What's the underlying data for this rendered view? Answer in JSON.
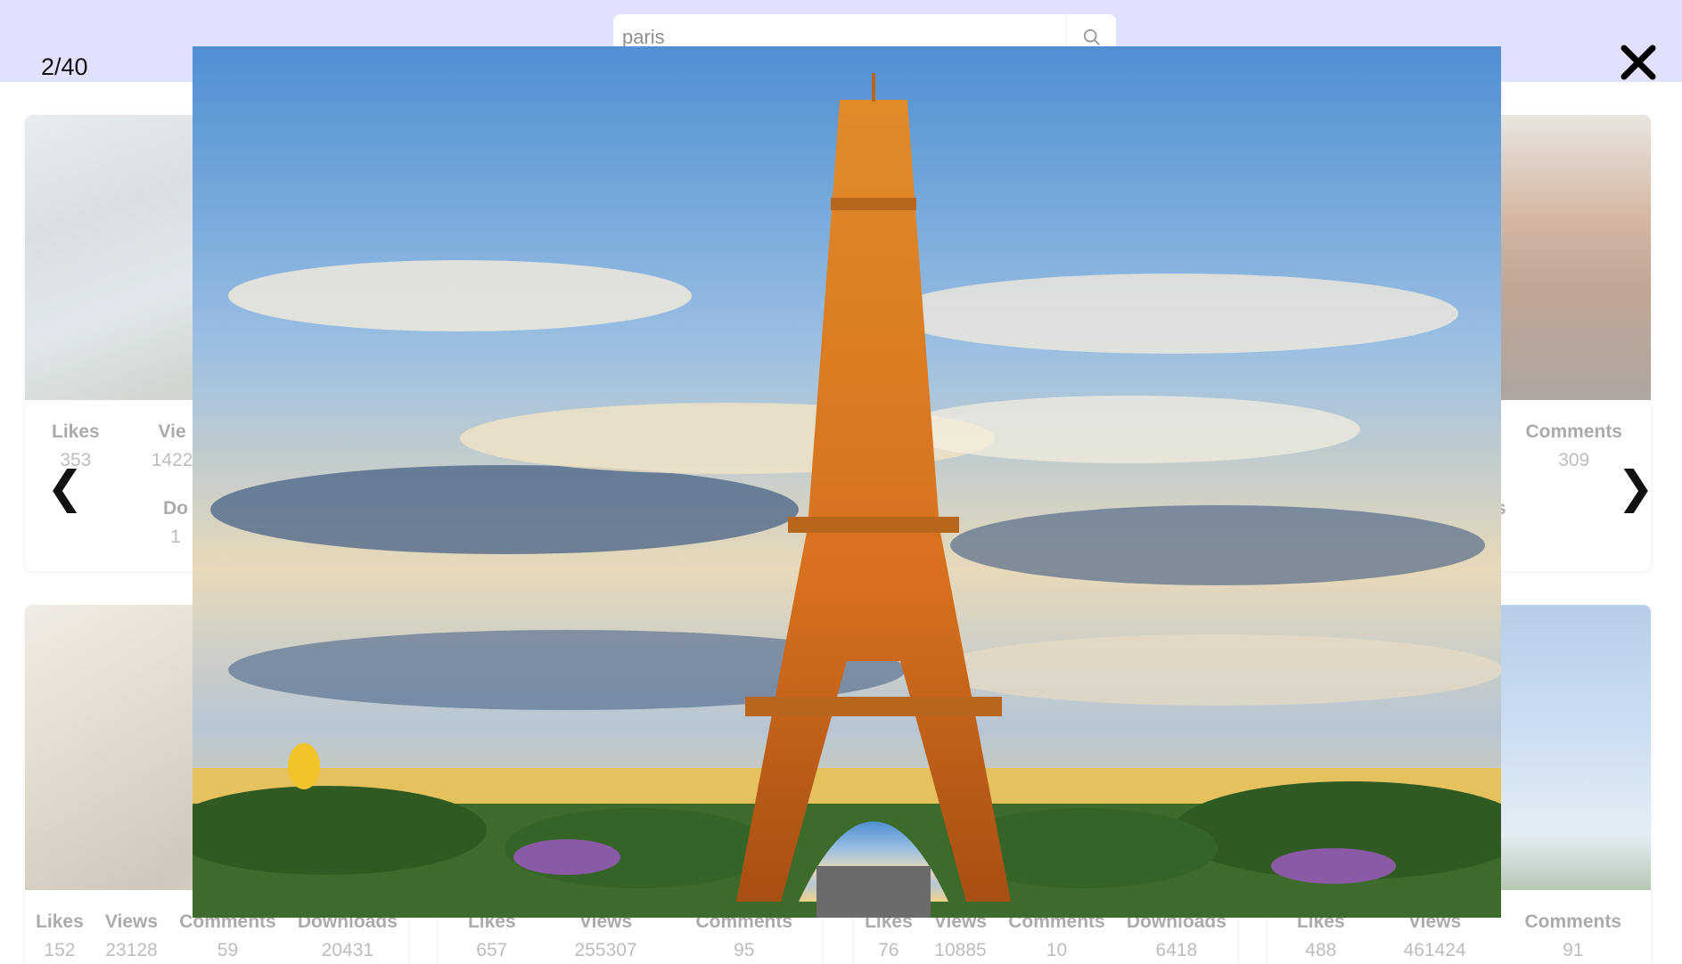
{
  "search": {
    "value": "paris"
  },
  "cards": [
    {
      "stats": [
        {
          "label": "Likes",
          "value": "353"
        },
        {
          "label": "Vie",
          "value": "1422"
        }
      ],
      "stats2": [
        {
          "label": "Do",
          "value": "1"
        }
      ]
    },
    {
      "stats": [
        {
          "label": "Comments",
          "value": "309"
        }
      ],
      "stats2": [
        {
          "label": "ls",
          "value": ""
        }
      ]
    },
    {
      "stats": [
        {
          "label": "Likes",
          "value": "152"
        },
        {
          "label": "Views",
          "value": "23128"
        },
        {
          "label": "Comments",
          "value": "59"
        },
        {
          "label": "Downloads",
          "value": "20431"
        }
      ]
    },
    {
      "stats": [
        {
          "label": "Likes",
          "value": "657"
        },
        {
          "label": "Views",
          "value": "255307"
        },
        {
          "label": "Comments",
          "value": "95"
        }
      ]
    },
    {
      "stats": [
        {
          "label": "Likes",
          "value": "76"
        },
        {
          "label": "Views",
          "value": "10885"
        },
        {
          "label": "Comments",
          "value": "10"
        },
        {
          "label": "Downloads",
          "value": "6418"
        }
      ]
    },
    {
      "stats": [
        {
          "label": "Likes",
          "value": "488"
        },
        {
          "label": "Views",
          "value": "461424"
        },
        {
          "label": "Comments",
          "value": "91"
        }
      ]
    }
  ],
  "lightbox": {
    "counter": "2/40",
    "prev_glyph": "❮",
    "next_glyph": "❯",
    "close_icon": "close-icon"
  },
  "colors": {
    "header": "#c9c9fb"
  }
}
